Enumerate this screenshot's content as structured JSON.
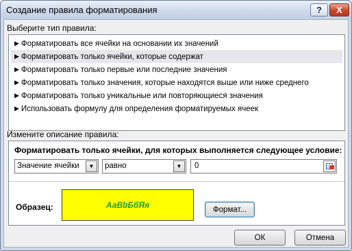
{
  "window": {
    "title": "Создание правила форматирования",
    "help": "?",
    "close": "X"
  },
  "rule_type": {
    "label": "Выберите тип правила:",
    "items": [
      "Форматировать все ячейки на основании их значений",
      "Форматировать только ячейки, которые содержат",
      "Форматировать только первые или последние значения",
      "Форматировать только значения, которые находятся выше или ниже среднего",
      "Форматировать только уникальные или повторяющиеся значения",
      "Использовать формулу для определения форматируемых ячеек"
    ],
    "selected_index": 1
  },
  "description": {
    "label": "Измените описание правила:",
    "heading": "Форматировать только ячейки, для которых выполняется следующее условие:",
    "condition_field": "Значение ячейки",
    "operator": "равно",
    "value": "0",
    "sample_label": "Образец:",
    "sample_text": "АаВbБбЯя",
    "format_button": "Формат..."
  },
  "buttons": {
    "ok": "ОК",
    "cancel": "Отмена"
  },
  "colors": {
    "preview_bg": "#ffff00",
    "preview_text": "#1e9a3a"
  }
}
